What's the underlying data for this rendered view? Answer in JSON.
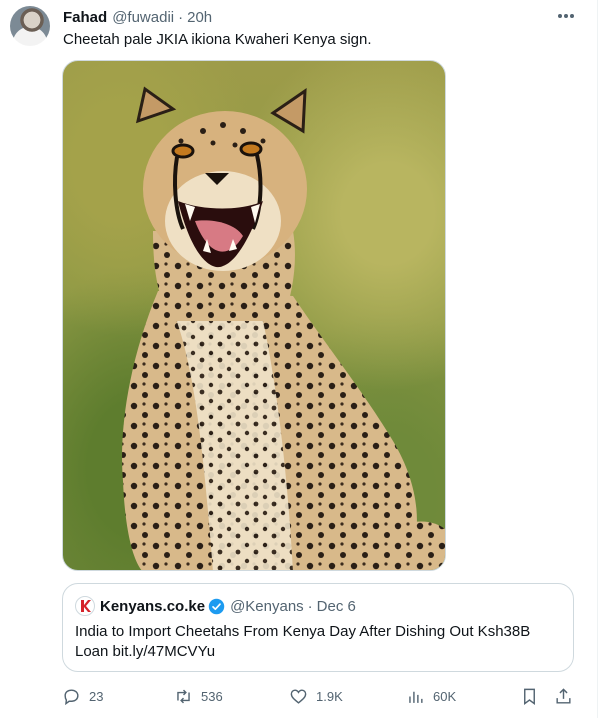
{
  "tweet": {
    "author_name": "Fahad",
    "author_handle": "@fuwadii",
    "separator": "·",
    "time": "20h",
    "text": "Cheetah pale JKIA ikiona Kwaheri Kenya sign."
  },
  "media": {
    "alt_subject": "cheetah-photo"
  },
  "quote": {
    "author_name": "Kenyans.co.ke",
    "author_handle": "@Kenyans",
    "separator": "·",
    "date": "Dec 6",
    "text": "India to Import Cheetahs From Kenya Day After Dishing Out Ksh38B Loan bit.ly/47MCVYu",
    "logo_color": "#d5232a",
    "verified_color": "#1d9bf0"
  },
  "actions": {
    "replies": "23",
    "retweets": "536",
    "likes": "1.9K",
    "views": "60K"
  },
  "icons": [
    "more-icon",
    "reply-icon",
    "retweet-icon",
    "like-icon",
    "views-icon",
    "bookmark-icon",
    "share-icon",
    "verified-icon"
  ]
}
